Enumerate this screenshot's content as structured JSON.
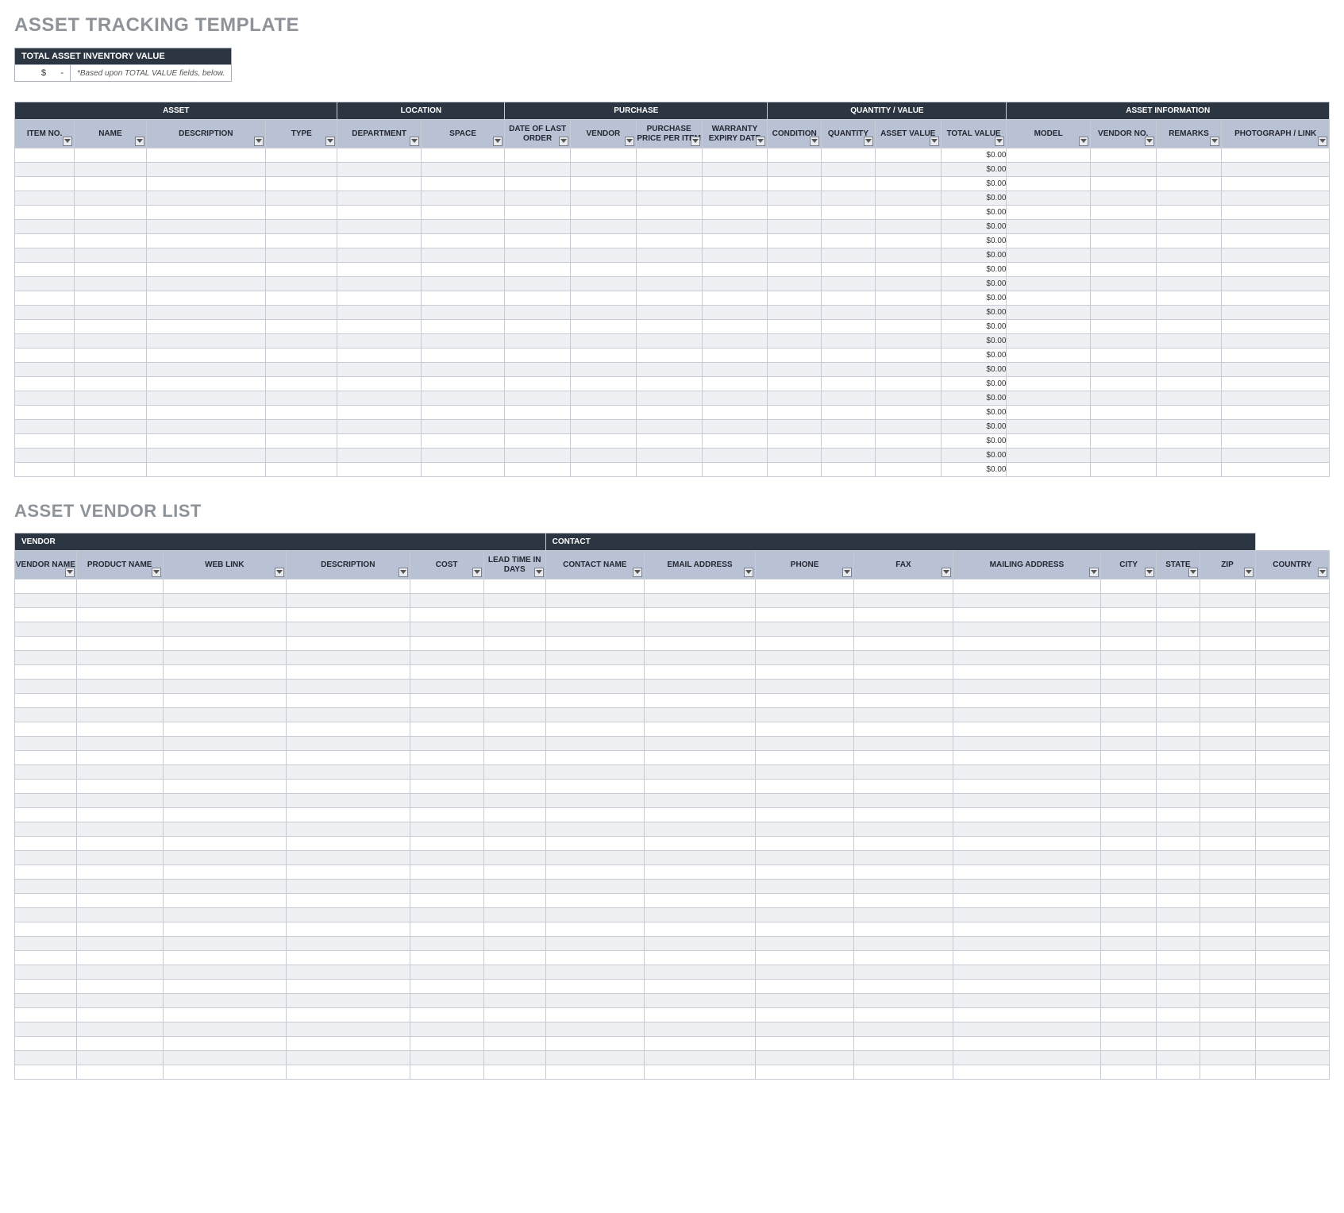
{
  "titles": {
    "main": "ASSET TRACKING TEMPLATE",
    "vendor": "ASSET VENDOR LIST"
  },
  "summary": {
    "header": "TOTAL ASSET INVENTORY VALUE",
    "value_prefix": "$",
    "value": "-",
    "note": "*Based upon TOTAL VALUE fields, below."
  },
  "asset_table": {
    "groups": [
      {
        "label": "ASSET",
        "span": 4
      },
      {
        "label": "LOCATION",
        "span": 2
      },
      {
        "label": "PURCHASE",
        "span": 4
      },
      {
        "label": "QUANTITY / VALUE",
        "span": 4
      },
      {
        "label": "ASSET INFORMATION",
        "span": 4
      }
    ],
    "columns": [
      "ITEM NO.",
      "NAME",
      "DESCRIPTION",
      "TYPE",
      "DEPARTMENT",
      "SPACE",
      "DATE OF LAST ORDER",
      "VENDOR",
      "PURCHASE PRICE PER ITEM",
      "WARRANTY EXPIRY DATE",
      "CONDITION",
      "QUANTITY",
      "ASSET VALUE",
      "TOTAL VALUE",
      "MODEL",
      "VENDOR NO.",
      "REMARKS",
      "PHOTOGRAPH / LINK"
    ],
    "row_count": 23,
    "total_value_col_index": 13,
    "cell_default": "$0.00"
  },
  "vendor_table": {
    "groups": [
      {
        "label": "VENDOR",
        "span": 6,
        "align": "left"
      },
      {
        "label": "CONTACT",
        "span": 8,
        "align": "left"
      }
    ],
    "columns": [
      "VENDOR NAME",
      "PRODUCT NAME",
      "WEB LINK",
      "DESCRIPTION",
      "COST",
      "LEAD TIME IN DAYS",
      "CONTACT NAME",
      "EMAIL ADDRESS",
      "PHONE",
      "FAX",
      "MAILING ADDRESS",
      "CITY",
      "STATE",
      "ZIP",
      "COUNTRY"
    ],
    "row_count": 35
  },
  "col_widths": {
    "asset": [
      50,
      60,
      100,
      60,
      70,
      70,
      55,
      55,
      55,
      55,
      45,
      45,
      55,
      55,
      70,
      55,
      55,
      90
    ],
    "vendor": [
      50,
      70,
      100,
      100,
      60,
      50,
      80,
      90,
      80,
      80,
      120,
      45,
      35,
      45,
      60
    ]
  }
}
